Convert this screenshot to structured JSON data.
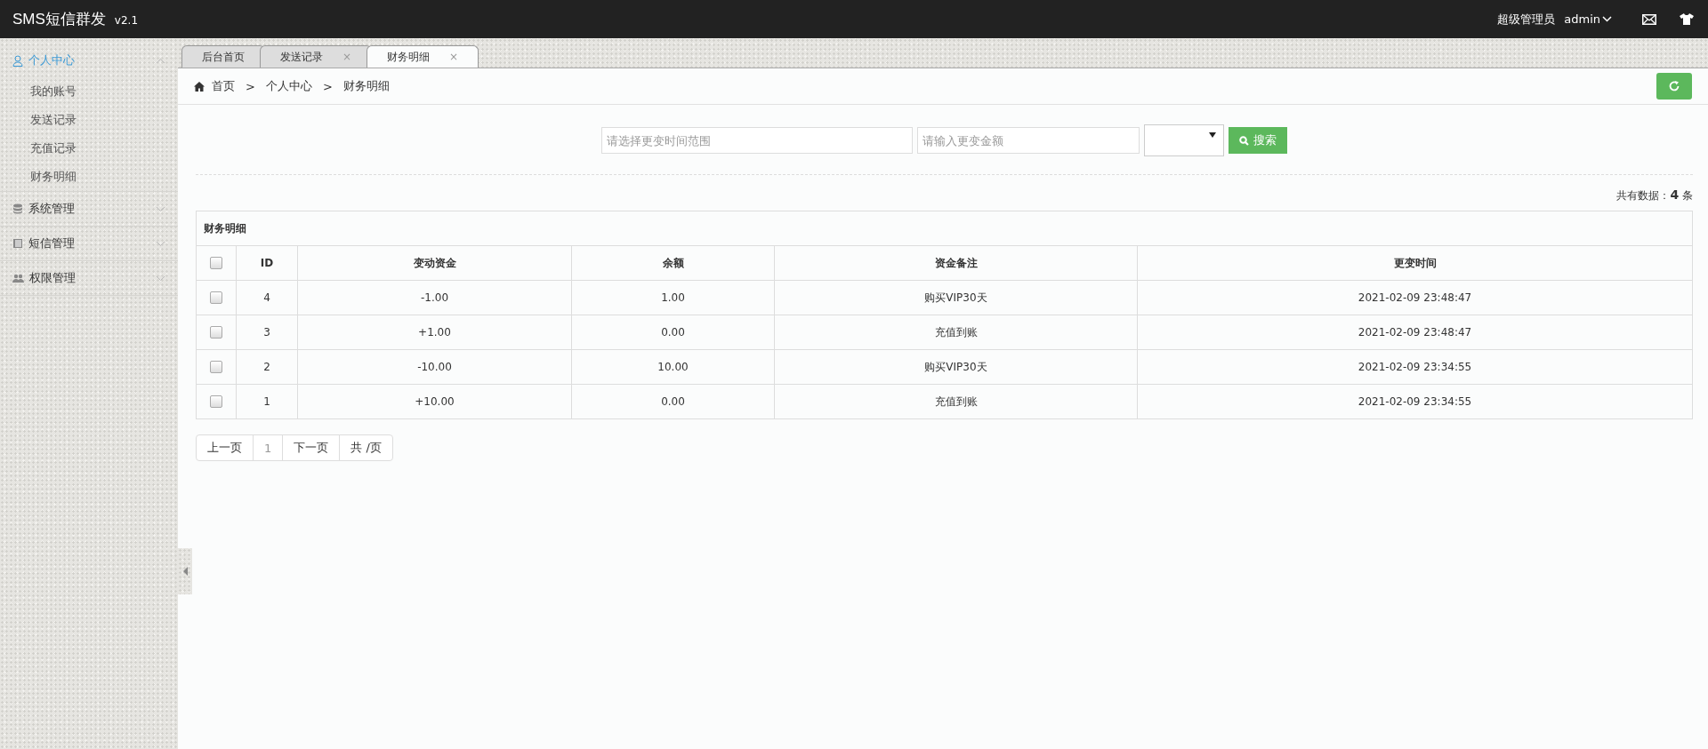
{
  "topbar": {
    "brand": "SMS短信群发",
    "version": "v2.1",
    "role": "超级管理员",
    "user": "admin"
  },
  "sidebar": {
    "groups": [
      {
        "label": "个人中心",
        "expanded": true,
        "selected": true,
        "children": [
          {
            "label": "我的账号"
          },
          {
            "label": "发送记录"
          },
          {
            "label": "充值记录"
          },
          {
            "label": "财务明细"
          }
        ]
      },
      {
        "label": "系统管理",
        "expanded": false,
        "selected": false
      },
      {
        "label": "短信管理",
        "expanded": false,
        "selected": false
      },
      {
        "label": "权限管理",
        "expanded": false,
        "selected": false
      }
    ]
  },
  "tabs": [
    {
      "label": "后台首页",
      "selected": false
    },
    {
      "label": "发送记录",
      "selected": false,
      "close": "×"
    },
    {
      "label": "财务明细",
      "selected": true,
      "close": "×"
    }
  ],
  "breadcrumb": [
    {
      "label": "首页"
    },
    {
      "separator": ">",
      "label": "个人中心"
    },
    {
      "separator": ">",
      "label": "财务明细"
    }
  ],
  "search": {
    "date_placeholder": "请选择更变时间范围",
    "amount_placeholder": "请输入更变金额",
    "button": "搜索"
  },
  "total": "共有数据：**4** 条",
  "table": {
    "title": "财务明细",
    "header_checked": false,
    "columns": [
      "ID",
      "变动资金",
      "余额",
      "资金备注",
      "更变时间"
    ],
    "rows": [
      {
        "checked": false,
        "cells": [
          "4",
          "-1.00",
          "1.00",
          "购买VIP30天",
          "2021-02-09 23:48:47"
        ]
      },
      {
        "checked": false,
        "cells": [
          "3",
          "+1.00",
          "0.00",
          "充值到账",
          "2021-02-09 23:48:47"
        ]
      },
      {
        "checked": false,
        "cells": [
          "2",
          "-10.00",
          "10.00",
          "购买VIP30天",
          "2021-02-09 23:34:55"
        ]
      },
      {
        "checked": false,
        "cells": [
          "1",
          "+10.00",
          "0.00",
          "充值到账",
          "2021-02-09 23:34:55"
        ]
      }
    ]
  },
  "pagination": [
    {
      "label": "上一页",
      "selected": false
    },
    {
      "label": "1",
      "selected": true
    },
    {
      "label": "下一页",
      "selected": false
    },
    {
      "label": "共 /页",
      "selected": false
    }
  ]
}
